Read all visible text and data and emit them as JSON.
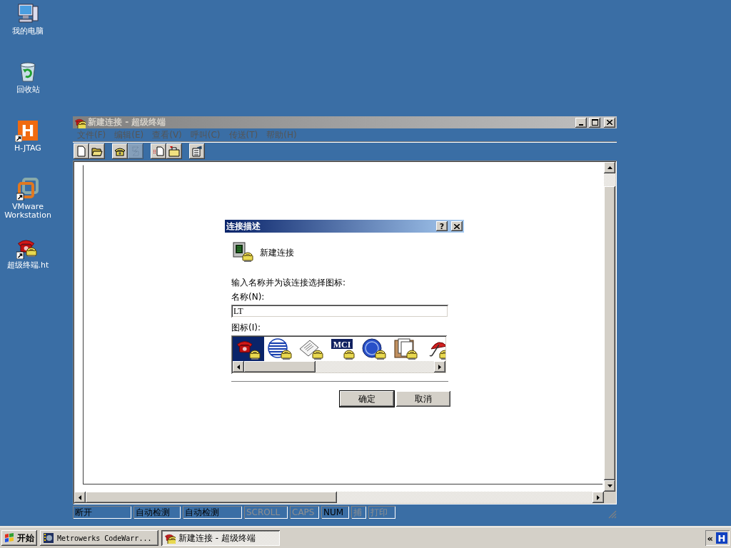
{
  "desktop_icons": [
    {
      "label": "我的电脑",
      "kind": "computer",
      "shortcut": false
    },
    {
      "label": "回收站",
      "kind": "recycle",
      "shortcut": false
    },
    {
      "label": "H-JTAG",
      "kind": "logo",
      "glyph": "H",
      "shortcut": true
    },
    {
      "label": "VMware Workstation",
      "kind": "vm",
      "shortcut": true
    },
    {
      "label": "超级终端.ht",
      "kind": "phone",
      "shortcut": true
    }
  ],
  "main_window": {
    "title": "新建连接 - 超级终端",
    "active": false,
    "menu": [
      {
        "label": "文件(F)"
      },
      {
        "label": "编辑(E)"
      },
      {
        "label": "查看(V)"
      },
      {
        "label": "呼叫(C)"
      },
      {
        "label": "传送(T)"
      },
      {
        "label": "帮助(H)"
      }
    ],
    "toolbar_groups": [
      {
        "buttons": [
          {
            "kind": "new",
            "disabled": false
          },
          {
            "kind": "open",
            "disabled": false
          }
        ]
      },
      {
        "buttons": [
          {
            "kind": "call",
            "disabled": false
          },
          {
            "kind": "hangup",
            "disabled": true
          }
        ]
      },
      {
        "buttons": [
          {
            "kind": "send",
            "disabled": false
          },
          {
            "kind": "receive",
            "disabled": false
          }
        ]
      },
      {
        "buttons": [
          {
            "kind": "properties",
            "disabled": false
          }
        ]
      }
    ],
    "status_bar": [
      {
        "text": "断开",
        "disabled": false
      },
      {
        "text": "自动检测",
        "disabled": false
      },
      {
        "text": "自动检测",
        "disabled": false
      },
      {
        "text": "SCROLL",
        "disabled": true
      },
      {
        "text": "CAPS",
        "disabled": true
      },
      {
        "text": "NUM",
        "disabled": false
      },
      {
        "text": "捕",
        "disabled": true
      },
      {
        "text": "打印",
        "disabled": true
      }
    ]
  },
  "dialog": {
    "title": "连接描述",
    "active": true,
    "help_button": "?",
    "connection_name": "新建连接",
    "prompt": "输入名称并为该连接选择图标:",
    "name_label": "名称(N):",
    "name_value": "LT",
    "icon_label": "图标(I):",
    "icons": [
      {
        "kind": "phone",
        "selected": true
      },
      {
        "kind": "globe",
        "selected": false
      },
      {
        "kind": "papers",
        "selected": false
      },
      {
        "kind": "logo",
        "text": "MCI",
        "selected": false
      },
      {
        "kind": "orb",
        "selected": false
      },
      {
        "kind": "documents",
        "selected": false
      },
      {
        "kind": "umbrella",
        "selected": false
      }
    ],
    "buttons": [
      {
        "label": "确定",
        "default": true
      },
      {
        "label": "取消",
        "default": false
      }
    ]
  },
  "taskbar": {
    "start": "开始",
    "tasks": [
      {
        "label": "Metrowerks CodeWarr...",
        "kind": "app",
        "selected": false
      },
      {
        "label": "新建连接 - 超级终端",
        "kind": "phone",
        "selected": true
      }
    ],
    "tray": {
      "expand": "«",
      "glyph": "H"
    }
  }
}
